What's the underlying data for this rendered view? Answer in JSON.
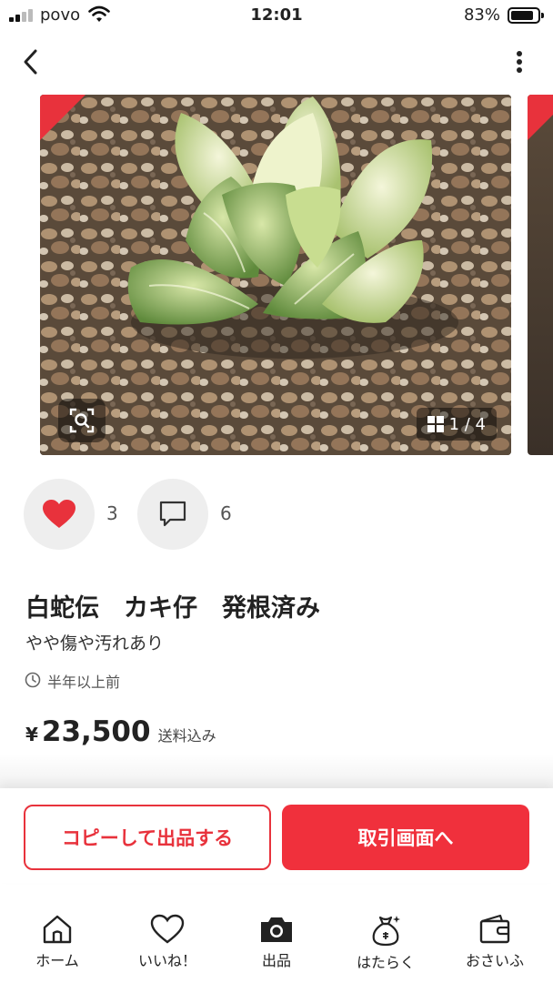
{
  "status_bar": {
    "carrier": "povo",
    "time": "12:01",
    "battery": "83%"
  },
  "item": {
    "image_counter": "1 / 4",
    "likes": "3",
    "comments": "6",
    "title": "白蛇伝　カキ仔　発根済み",
    "condition": "やや傷や汚れあり",
    "posted": "半年以上前",
    "currency": "¥",
    "price": "23,500",
    "shipping_note": "送料込み"
  },
  "actions": {
    "copy_label": "コピーして出品する",
    "trade_label": "取引画面へ"
  },
  "tabs": [
    {
      "label": "ホーム",
      "icon": "home-icon"
    },
    {
      "label": "いいね！",
      "icon": "heart-outline-icon"
    },
    {
      "label": "出品",
      "icon": "camera-icon"
    },
    {
      "label": "はたらく",
      "icon": "money-bag-icon"
    },
    {
      "label": "おさいふ",
      "icon": "wallet-icon"
    }
  ],
  "colors": {
    "accent": "#f0303c",
    "like": "#e8323c"
  }
}
